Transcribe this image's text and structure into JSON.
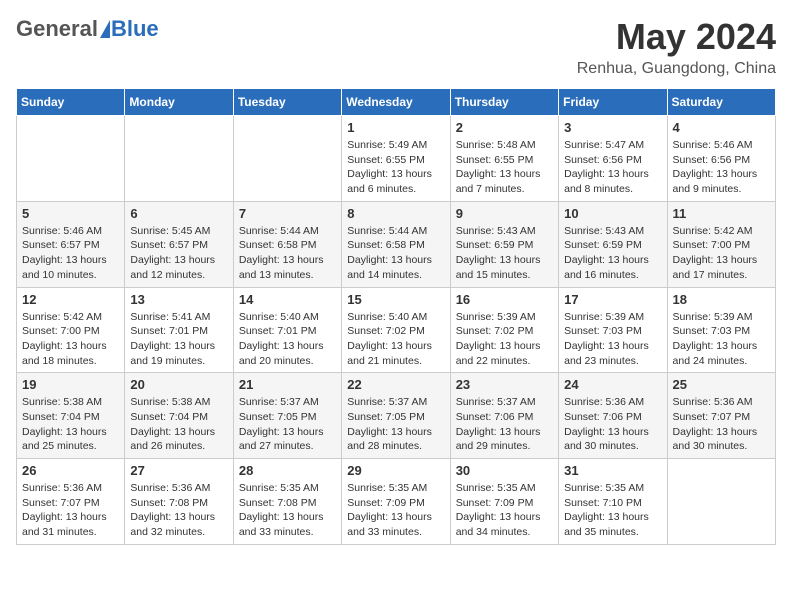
{
  "logo": {
    "general": "General",
    "blue": "Blue"
  },
  "header": {
    "month": "May 2024",
    "location": "Renhua, Guangdong, China"
  },
  "weekdays": [
    "Sunday",
    "Monday",
    "Tuesday",
    "Wednesday",
    "Thursday",
    "Friday",
    "Saturday"
  ],
  "weeks": [
    [
      {
        "day": "",
        "info": ""
      },
      {
        "day": "",
        "info": ""
      },
      {
        "day": "",
        "info": ""
      },
      {
        "day": "1",
        "info": "Sunrise: 5:49 AM\nSunset: 6:55 PM\nDaylight: 13 hours\nand 6 minutes."
      },
      {
        "day": "2",
        "info": "Sunrise: 5:48 AM\nSunset: 6:55 PM\nDaylight: 13 hours\nand 7 minutes."
      },
      {
        "day": "3",
        "info": "Sunrise: 5:47 AM\nSunset: 6:56 PM\nDaylight: 13 hours\nand 8 minutes."
      },
      {
        "day": "4",
        "info": "Sunrise: 5:46 AM\nSunset: 6:56 PM\nDaylight: 13 hours\nand 9 minutes."
      }
    ],
    [
      {
        "day": "5",
        "info": "Sunrise: 5:46 AM\nSunset: 6:57 PM\nDaylight: 13 hours\nand 10 minutes."
      },
      {
        "day": "6",
        "info": "Sunrise: 5:45 AM\nSunset: 6:57 PM\nDaylight: 13 hours\nand 12 minutes."
      },
      {
        "day": "7",
        "info": "Sunrise: 5:44 AM\nSunset: 6:58 PM\nDaylight: 13 hours\nand 13 minutes."
      },
      {
        "day": "8",
        "info": "Sunrise: 5:44 AM\nSunset: 6:58 PM\nDaylight: 13 hours\nand 14 minutes."
      },
      {
        "day": "9",
        "info": "Sunrise: 5:43 AM\nSunset: 6:59 PM\nDaylight: 13 hours\nand 15 minutes."
      },
      {
        "day": "10",
        "info": "Sunrise: 5:43 AM\nSunset: 6:59 PM\nDaylight: 13 hours\nand 16 minutes."
      },
      {
        "day": "11",
        "info": "Sunrise: 5:42 AM\nSunset: 7:00 PM\nDaylight: 13 hours\nand 17 minutes."
      }
    ],
    [
      {
        "day": "12",
        "info": "Sunrise: 5:42 AM\nSunset: 7:00 PM\nDaylight: 13 hours\nand 18 minutes."
      },
      {
        "day": "13",
        "info": "Sunrise: 5:41 AM\nSunset: 7:01 PM\nDaylight: 13 hours\nand 19 minutes."
      },
      {
        "day": "14",
        "info": "Sunrise: 5:40 AM\nSunset: 7:01 PM\nDaylight: 13 hours\nand 20 minutes."
      },
      {
        "day": "15",
        "info": "Sunrise: 5:40 AM\nSunset: 7:02 PM\nDaylight: 13 hours\nand 21 minutes."
      },
      {
        "day": "16",
        "info": "Sunrise: 5:39 AM\nSunset: 7:02 PM\nDaylight: 13 hours\nand 22 minutes."
      },
      {
        "day": "17",
        "info": "Sunrise: 5:39 AM\nSunset: 7:03 PM\nDaylight: 13 hours\nand 23 minutes."
      },
      {
        "day": "18",
        "info": "Sunrise: 5:39 AM\nSunset: 7:03 PM\nDaylight: 13 hours\nand 24 minutes."
      }
    ],
    [
      {
        "day": "19",
        "info": "Sunrise: 5:38 AM\nSunset: 7:04 PM\nDaylight: 13 hours\nand 25 minutes."
      },
      {
        "day": "20",
        "info": "Sunrise: 5:38 AM\nSunset: 7:04 PM\nDaylight: 13 hours\nand 26 minutes."
      },
      {
        "day": "21",
        "info": "Sunrise: 5:37 AM\nSunset: 7:05 PM\nDaylight: 13 hours\nand 27 minutes."
      },
      {
        "day": "22",
        "info": "Sunrise: 5:37 AM\nSunset: 7:05 PM\nDaylight: 13 hours\nand 28 minutes."
      },
      {
        "day": "23",
        "info": "Sunrise: 5:37 AM\nSunset: 7:06 PM\nDaylight: 13 hours\nand 29 minutes."
      },
      {
        "day": "24",
        "info": "Sunrise: 5:36 AM\nSunset: 7:06 PM\nDaylight: 13 hours\nand 30 minutes."
      },
      {
        "day": "25",
        "info": "Sunrise: 5:36 AM\nSunset: 7:07 PM\nDaylight: 13 hours\nand 30 minutes."
      }
    ],
    [
      {
        "day": "26",
        "info": "Sunrise: 5:36 AM\nSunset: 7:07 PM\nDaylight: 13 hours\nand 31 minutes."
      },
      {
        "day": "27",
        "info": "Sunrise: 5:36 AM\nSunset: 7:08 PM\nDaylight: 13 hours\nand 32 minutes."
      },
      {
        "day": "28",
        "info": "Sunrise: 5:35 AM\nSunset: 7:08 PM\nDaylight: 13 hours\nand 33 minutes."
      },
      {
        "day": "29",
        "info": "Sunrise: 5:35 AM\nSunset: 7:09 PM\nDaylight: 13 hours\nand 33 minutes."
      },
      {
        "day": "30",
        "info": "Sunrise: 5:35 AM\nSunset: 7:09 PM\nDaylight: 13 hours\nand 34 minutes."
      },
      {
        "day": "31",
        "info": "Sunrise: 5:35 AM\nSunset: 7:10 PM\nDaylight: 13 hours\nand 35 minutes."
      },
      {
        "day": "",
        "info": ""
      }
    ]
  ]
}
